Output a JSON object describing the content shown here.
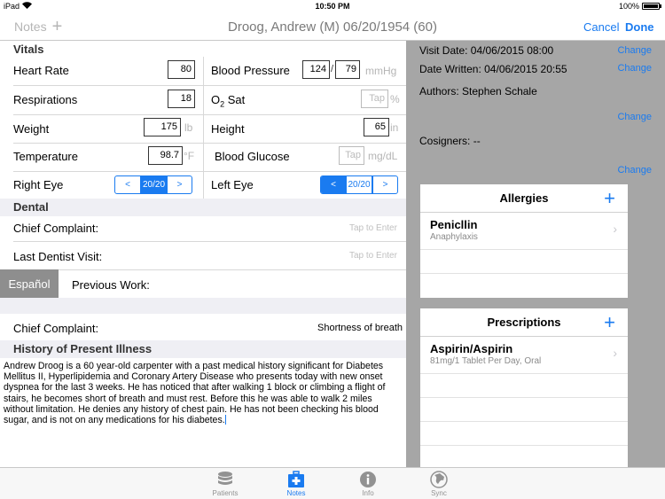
{
  "status_bar": {
    "carrier": "iPad",
    "time": "10:50 PM",
    "battery": "100%"
  },
  "nav": {
    "notes_label": "Notes",
    "add_icon": "plus-icon",
    "title": "Droog, Andrew (M) 06/20/1954 (60)",
    "cancel_label": "Cancel",
    "done_label": "Done"
  },
  "vitals": {
    "header": "Vitals",
    "heart_rate": {
      "label": "Heart Rate",
      "value": "80"
    },
    "blood_pressure": {
      "label": "Blood Pressure",
      "systolic": "124",
      "separator": "/",
      "diastolic": "79",
      "unit": "mmHg"
    },
    "respirations": {
      "label": "Respirations",
      "value": "18"
    },
    "o2_sat": {
      "label_main": "O",
      "label_sub": "2",
      "label_rest": " Sat",
      "placeholder": "Tap",
      "unit": "%"
    },
    "weight": {
      "label": "Weight",
      "value": "175",
      "unit": "lb"
    },
    "height": {
      "label": "Height",
      "value": "65",
      "unit": "in"
    },
    "temperature": {
      "label": "Temperature",
      "value": "98.7",
      "unit": "°F"
    },
    "blood_glucose": {
      "label": "Blood Glucose",
      "placeholder": "Tap",
      "unit": "mg/dL"
    },
    "right_eye": {
      "label": "Right Eye",
      "dec": "<",
      "value": "20/20",
      "inc": ">"
    },
    "left_eye": {
      "label": "Left Eye",
      "dec": "<",
      "value": "20/20",
      "inc": ">"
    }
  },
  "dental": {
    "header": "Dental",
    "chief_complaint": {
      "label": "Chief Complaint:",
      "placeholder": "Tap to Enter"
    },
    "last_dentist_visit": {
      "label": "Last Dentist Visit:",
      "placeholder": "Tap to Enter"
    },
    "espanol_label": "Español",
    "previous_work": {
      "label": "Previous Work:"
    }
  },
  "complaint": {
    "label": "Chief Complaint:",
    "value": "Shortness of breath"
  },
  "hpi": {
    "header": "History of Present Illness",
    "text": "Andrew Droog is a 60 year-old carpenter with a past medical history significant for Diabetes Mellitus II, Hyperlipidemia and Coronary Artery Disease who presents today with new onset dyspnea for the last 3 weeks. He has noticed that after walking 1 block or climbing a flight of stairs, he becomes short of breath and must rest. Before this he was able to walk 2 miles without limitation. He denies any history of chest pain. He has not been checking his blood sugar, and is not on any medications for his diabetes."
  },
  "info": {
    "visit_date": "Visit Date: 04/06/2015 08:00",
    "date_written": "Date Written: 04/06/2015 20:55",
    "authors": "Authors: Stephen Schale",
    "cosigners": "Cosigners: --",
    "change_label": "Change"
  },
  "allergies": {
    "title": "Allergies",
    "items": [
      {
        "name": "Penicllin",
        "detail": "Anaphylaxis"
      }
    ]
  },
  "prescriptions": {
    "title": "Prescriptions",
    "items": [
      {
        "name": "Aspirin/Aspirin",
        "detail": "81mg/1 Tablet Per Day, Oral"
      }
    ]
  },
  "tabs": [
    {
      "label": "Patients",
      "icon": "database-icon",
      "active": false
    },
    {
      "label": "Notes",
      "icon": "medical-kit-icon",
      "active": true
    },
    {
      "label": "Info",
      "icon": "info-icon",
      "active": false
    },
    {
      "label": "Sync",
      "icon": "globe-icon",
      "active": false
    }
  ]
}
